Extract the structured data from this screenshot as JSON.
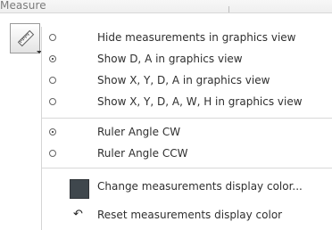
{
  "header": {
    "title": "Measure"
  },
  "menu": {
    "items": [
      {
        "label": "Hide measurements in graphics view",
        "selected": false
      },
      {
        "label": "Show D, A in graphics view",
        "selected": true
      },
      {
        "label": "Show X, Y, D, A in graphics view",
        "selected": false
      },
      {
        "label": "Show X, Y, D, A, W, H in graphics view",
        "selected": false
      },
      {
        "label": "Ruler Angle CW",
        "selected": true
      },
      {
        "label": "Ruler Angle CCW",
        "selected": false
      }
    ],
    "actions": [
      {
        "label": "Change measurements display color..."
      },
      {
        "label": "Reset measurements display color"
      }
    ],
    "color_swatch": "#3f474d",
    "reset_icon": "undo-icon"
  }
}
